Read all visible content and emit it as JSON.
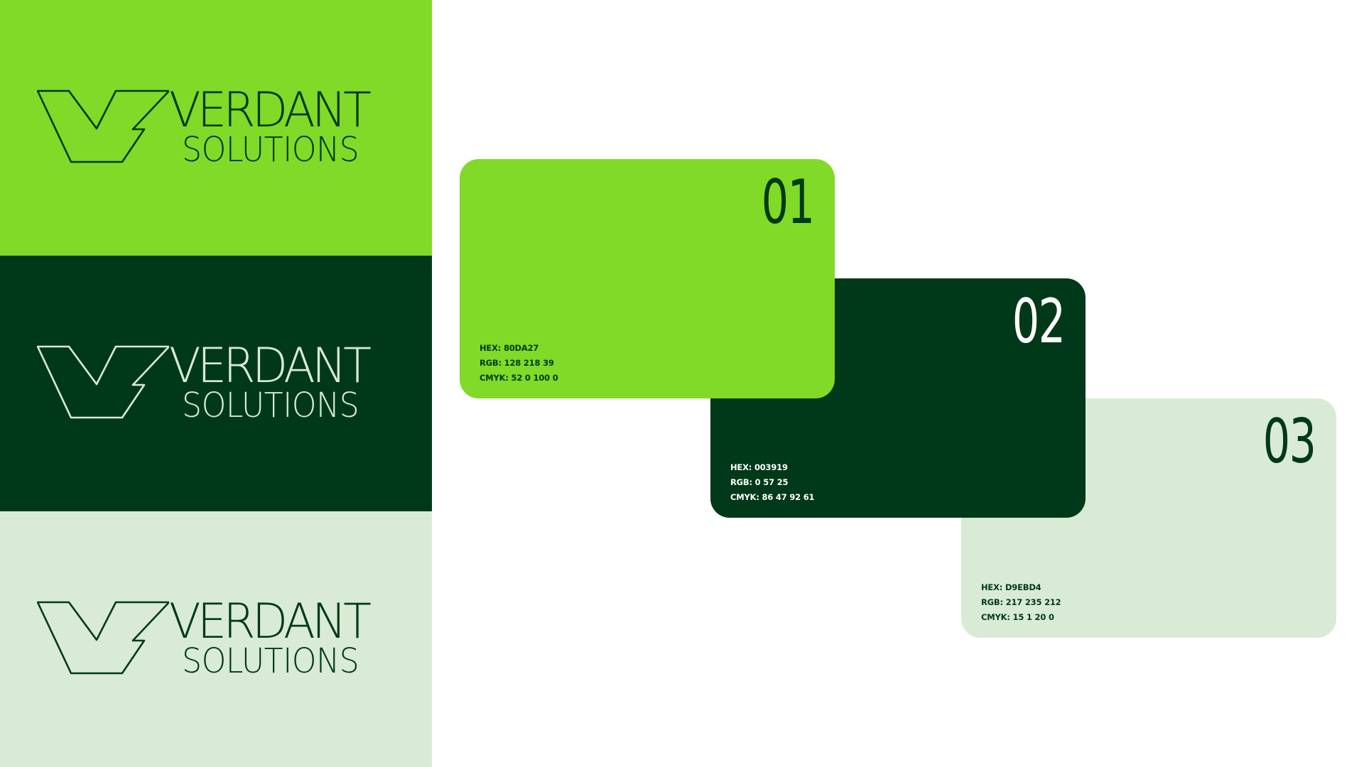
{
  "brand": {
    "line1": "VERDANT",
    "line2": "SOLUTIONS"
  },
  "logo_panels": [
    {
      "background": "#80DA27",
      "ink": "#003919"
    },
    {
      "background": "#003919",
      "ink": "#D9EBD4"
    },
    {
      "background": "#D9EBD4",
      "ink": "#003919"
    }
  ],
  "swatches": [
    {
      "number": "01",
      "background": "#80DA27",
      "ink": "#003919",
      "hex": "HEX: 80DA27",
      "rgb": "RGB: 128 218 39",
      "cmyk": "CMYK: 52 0 100 0"
    },
    {
      "number": "02",
      "background": "#003919",
      "ink": "#FFFFFF",
      "hex": "HEX: 003919",
      "rgb": "RGB: 0 57 25",
      "cmyk": "CMYK: 86 47 92 61"
    },
    {
      "number": "03",
      "background": "#D9EBD4",
      "ink": "#003919",
      "hex": "HEX: D9EBD4",
      "rgb": "RGB: 217 235 212",
      "cmyk": "CMYK: 15 1 20 0"
    }
  ],
  "icons": {
    "logo_mark": "vs-monogram-icon"
  }
}
